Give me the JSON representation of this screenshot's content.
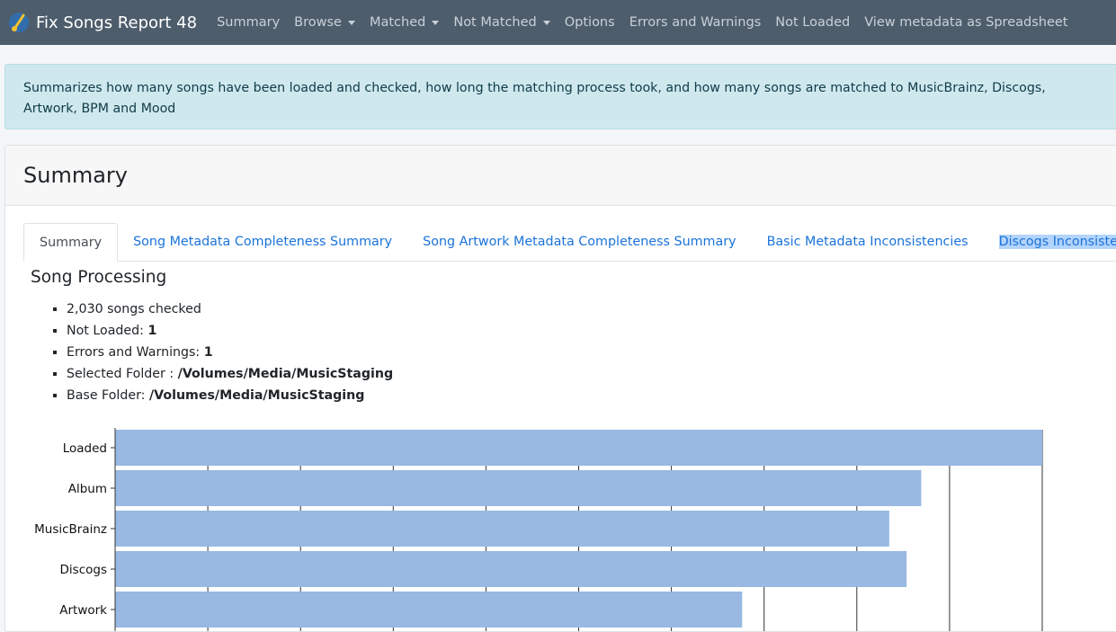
{
  "app": {
    "title": "Fix Songs Report 48",
    "logo_icon": "music-note-icon",
    "navbar_color": "#4e5d6c"
  },
  "nav": {
    "items": [
      {
        "label": "Summary",
        "dropdown": false
      },
      {
        "label": "Browse",
        "dropdown": true
      },
      {
        "label": "Matched",
        "dropdown": true
      },
      {
        "label": "Not Matched",
        "dropdown": true
      },
      {
        "label": "Options",
        "dropdown": false
      },
      {
        "label": "Errors and Warnings",
        "dropdown": false
      },
      {
        "label": "Not Loaded",
        "dropdown": false
      },
      {
        "label": "View metadata as Spreadsheet",
        "dropdown": false
      }
    ]
  },
  "info": {
    "text": "Summarizes how many songs have been loaded and checked, how long the matching process took, and how many songs are matched to MusicBrainz, Discogs, Artwork, BPM and Mood"
  },
  "card": {
    "title": "Summary"
  },
  "tabs": [
    {
      "label": "Summary",
      "active": true
    },
    {
      "label": "Song Metadata Completeness Summary",
      "active": false
    },
    {
      "label": "Song Artwork Metadata Completeness Summary",
      "active": false
    },
    {
      "label": "Basic Metadata Inconsistencies",
      "active": false
    },
    {
      "label": "Discogs Inconsistencies",
      "active": false
    }
  ],
  "processing": {
    "title": "Song Processing",
    "songs_checked": "2,030 songs checked",
    "not_loaded_label": "Not Loaded:",
    "not_loaded_value": "1",
    "errors_label": "Errors and Warnings:",
    "errors_value": "1",
    "selected_folder_label": "Selected Folder :",
    "selected_folder_value": "/Volumes/Media/MusicStaging",
    "base_folder_label": "Base Folder:",
    "base_folder_value": "/Volumes/Media/MusicStaging"
  },
  "chart_data": {
    "type": "bar",
    "orientation": "horizontal",
    "categories": [
      "Loaded",
      "Album",
      "MusicBrainz",
      "Discogs",
      "Artwork"
    ],
    "values": [
      2030,
      1765,
      1695,
      1733,
      1373
    ],
    "xlim": [
      0,
      2030
    ],
    "grid": true,
    "bar_color": "#99b8e2"
  }
}
